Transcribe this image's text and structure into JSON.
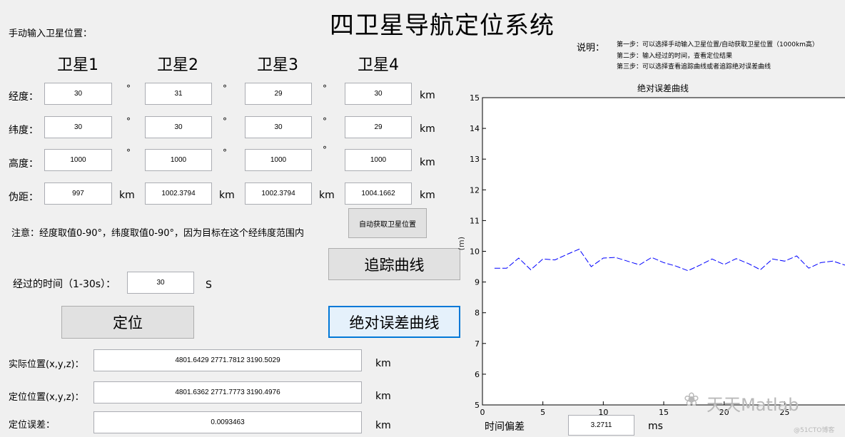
{
  "app_title": "四卫星导航定位系统",
  "manual_label": "手动输入卫星位置：",
  "sat_headers": [
    "卫星1",
    "卫星2",
    "卫星3",
    "卫星4"
  ],
  "row_labels": [
    "经度：",
    "纬度：",
    "高度：",
    "伪距："
  ],
  "units": {
    "deg": "°",
    "km": "km",
    "s": "S",
    "ms": "ms"
  },
  "sat_values": {
    "lon": [
      "30",
      "31",
      "29",
      "30"
    ],
    "lat": [
      "30",
      "30",
      "30",
      "29"
    ],
    "alt": [
      "1000",
      "1000",
      "1000",
      "1000"
    ],
    "pr": [
      "997",
      "1002.3794",
      "1002.3794",
      "1004.1662"
    ]
  },
  "notice": "注意：经度取值0-90°，纬度取值0-90°，因为目标在这个经纬度范围内",
  "auto_button": "自动获取卫星位置",
  "track_button": "追踪曲线",
  "abs_err_button": "绝对误差曲线",
  "locate_button": "定位",
  "elapsed_label": "经过的时间（1-30s）：",
  "elapsed_value": "30",
  "actual_label": "实际位置(x,y,z)：",
  "actual_value": "4801.6429    2771.7812    3190.5029",
  "located_label": "定位位置(x,y,z)：",
  "located_value": "4801.6362    2771.7773    3190.4976",
  "error_label": "定位误差：",
  "error_value": "0.0093463",
  "instructions": {
    "heading": "说明：",
    "steps": [
      "第一步：可以选择手动输入卫星位置/自动获取卫星位置（1000km高）",
      "第二步：输入经过的时间，查看定位结果",
      "第三步：可以选择查看追踪曲线或者追踪绝对误差曲线"
    ]
  },
  "time_offset_label": "时间偏差",
  "time_offset_value": "3.2711",
  "watermark": {
    "name": "天天Matlab",
    "site": "@51CTO博客"
  },
  "colors": {
    "line": "#0000ff",
    "bg": "#f0f0f0"
  },
  "chart_data": {
    "type": "line",
    "title": "绝对误差曲线",
    "xlabel": "",
    "ylabel": "",
    "xlim": [
      0,
      30
    ],
    "ylim": [
      5,
      15
    ],
    "xticks": [
      0,
      5,
      10,
      15,
      20,
      25
    ],
    "yticks": [
      5,
      6,
      7,
      8,
      9,
      10,
      11,
      12,
      13,
      14,
      15
    ],
    "grid": false,
    "series": [
      {
        "x": [
          1,
          2,
          3,
          4,
          5,
          6,
          7,
          8,
          9,
          10,
          11,
          12,
          13,
          14,
          15,
          16,
          17,
          18,
          19,
          20,
          21,
          22,
          23,
          24,
          25,
          26,
          27,
          28,
          29,
          30
        ],
        "values": [
          9.45,
          9.45,
          9.78,
          9.4,
          9.75,
          9.72,
          9.9,
          10.07,
          9.5,
          9.78,
          9.8,
          9.68,
          9.56,
          9.8,
          9.63,
          9.52,
          9.37,
          9.55,
          9.75,
          9.57,
          9.76,
          9.6,
          9.4,
          9.75,
          9.68,
          9.85,
          9.45,
          9.63,
          9.68,
          9.55
        ]
      }
    ]
  }
}
